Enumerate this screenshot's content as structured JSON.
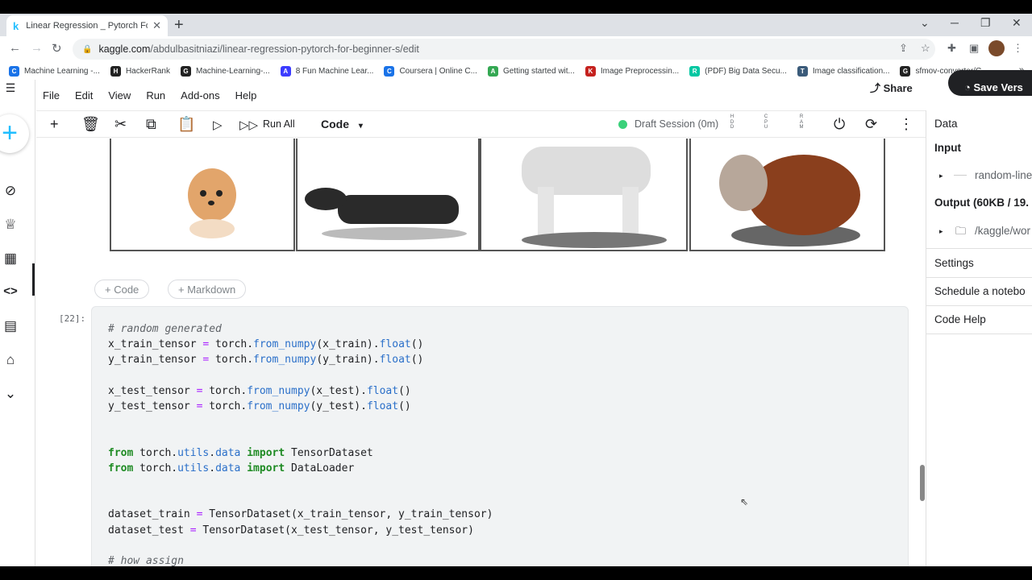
{
  "browser": {
    "tab_title": "Linear Regression _ Pytorch For B",
    "url_host": "kaggle.com",
    "url_path": "/abdulbasitniazi/linear-regression-pytorch-for-beginner-s/edit",
    "bookmarks": [
      {
        "label": "Machine Learning -...",
        "icon": "C",
        "color": "#1a73e8"
      },
      {
        "label": "HackerRank",
        "icon": "H",
        "color": "#222222"
      },
      {
        "label": "Machine-Learning-...",
        "icon": "G",
        "color": "#222222"
      },
      {
        "label": "8 Fun Machine Lear...",
        "icon": "A",
        "color": "#3c3cff"
      },
      {
        "label": "Coursera | Online C...",
        "icon": "C",
        "color": "#1a73e8"
      },
      {
        "label": "Getting started wit...",
        "icon": "A",
        "color": "#34a853"
      },
      {
        "label": "Image Preprocessin...",
        "icon": "K",
        "color": "#c5221f"
      },
      {
        "label": "(PDF) Big Data Secu...",
        "icon": "R",
        "color": "#00c7a2"
      },
      {
        "label": "Image classification...",
        "icon": "T",
        "color": "#3b5b7a"
      },
      {
        "label": "sfmov-converter/C...",
        "icon": "G",
        "color": "#222222"
      }
    ],
    "bookmarks_more": "»"
  },
  "menu": {
    "items": [
      "File",
      "Edit",
      "View",
      "Run",
      "Add-ons",
      "Help"
    ],
    "share": "Share",
    "save_version": "Save Vers"
  },
  "toolbar": {
    "run_all": "Run All",
    "cell_type": "Code",
    "session": "Draft Session (0m)",
    "meters": [
      "H D D",
      "C P U",
      "R A M"
    ]
  },
  "notebook": {
    "add_code": "+ Code",
    "add_markdown": "+ Markdown",
    "cell_number": "[22]:",
    "code_lines": [
      "# random generated",
      "x_train_tensor = torch.from_numpy(x_train).float()",
      "y_train_tensor = torch.from_numpy(y_train).float()",
      "",
      "x_test_tensor = torch.from_numpy(x_test).float()",
      "y_test_tensor = torch.from_numpy(y_test).float()",
      "",
      "",
      "from torch.utils.data import TensorDataset",
      "from torch.utils.data import DataLoader",
      "",
      "",
      "dataset_train = TensorDataset(x_train_tensor, y_train_tensor)",
      "dataset_test = TensorDataset(x_test_tensor, y_test_tensor)",
      "",
      "# how assign"
    ]
  },
  "right_panel": {
    "data": "Data",
    "input": "Input",
    "input_item": "random-line",
    "output": "Output (60KB / 19.",
    "output_item": "/kaggle/wor",
    "settings": "Settings",
    "schedule": "Schedule a notebo",
    "code_help": "Code Help"
  }
}
